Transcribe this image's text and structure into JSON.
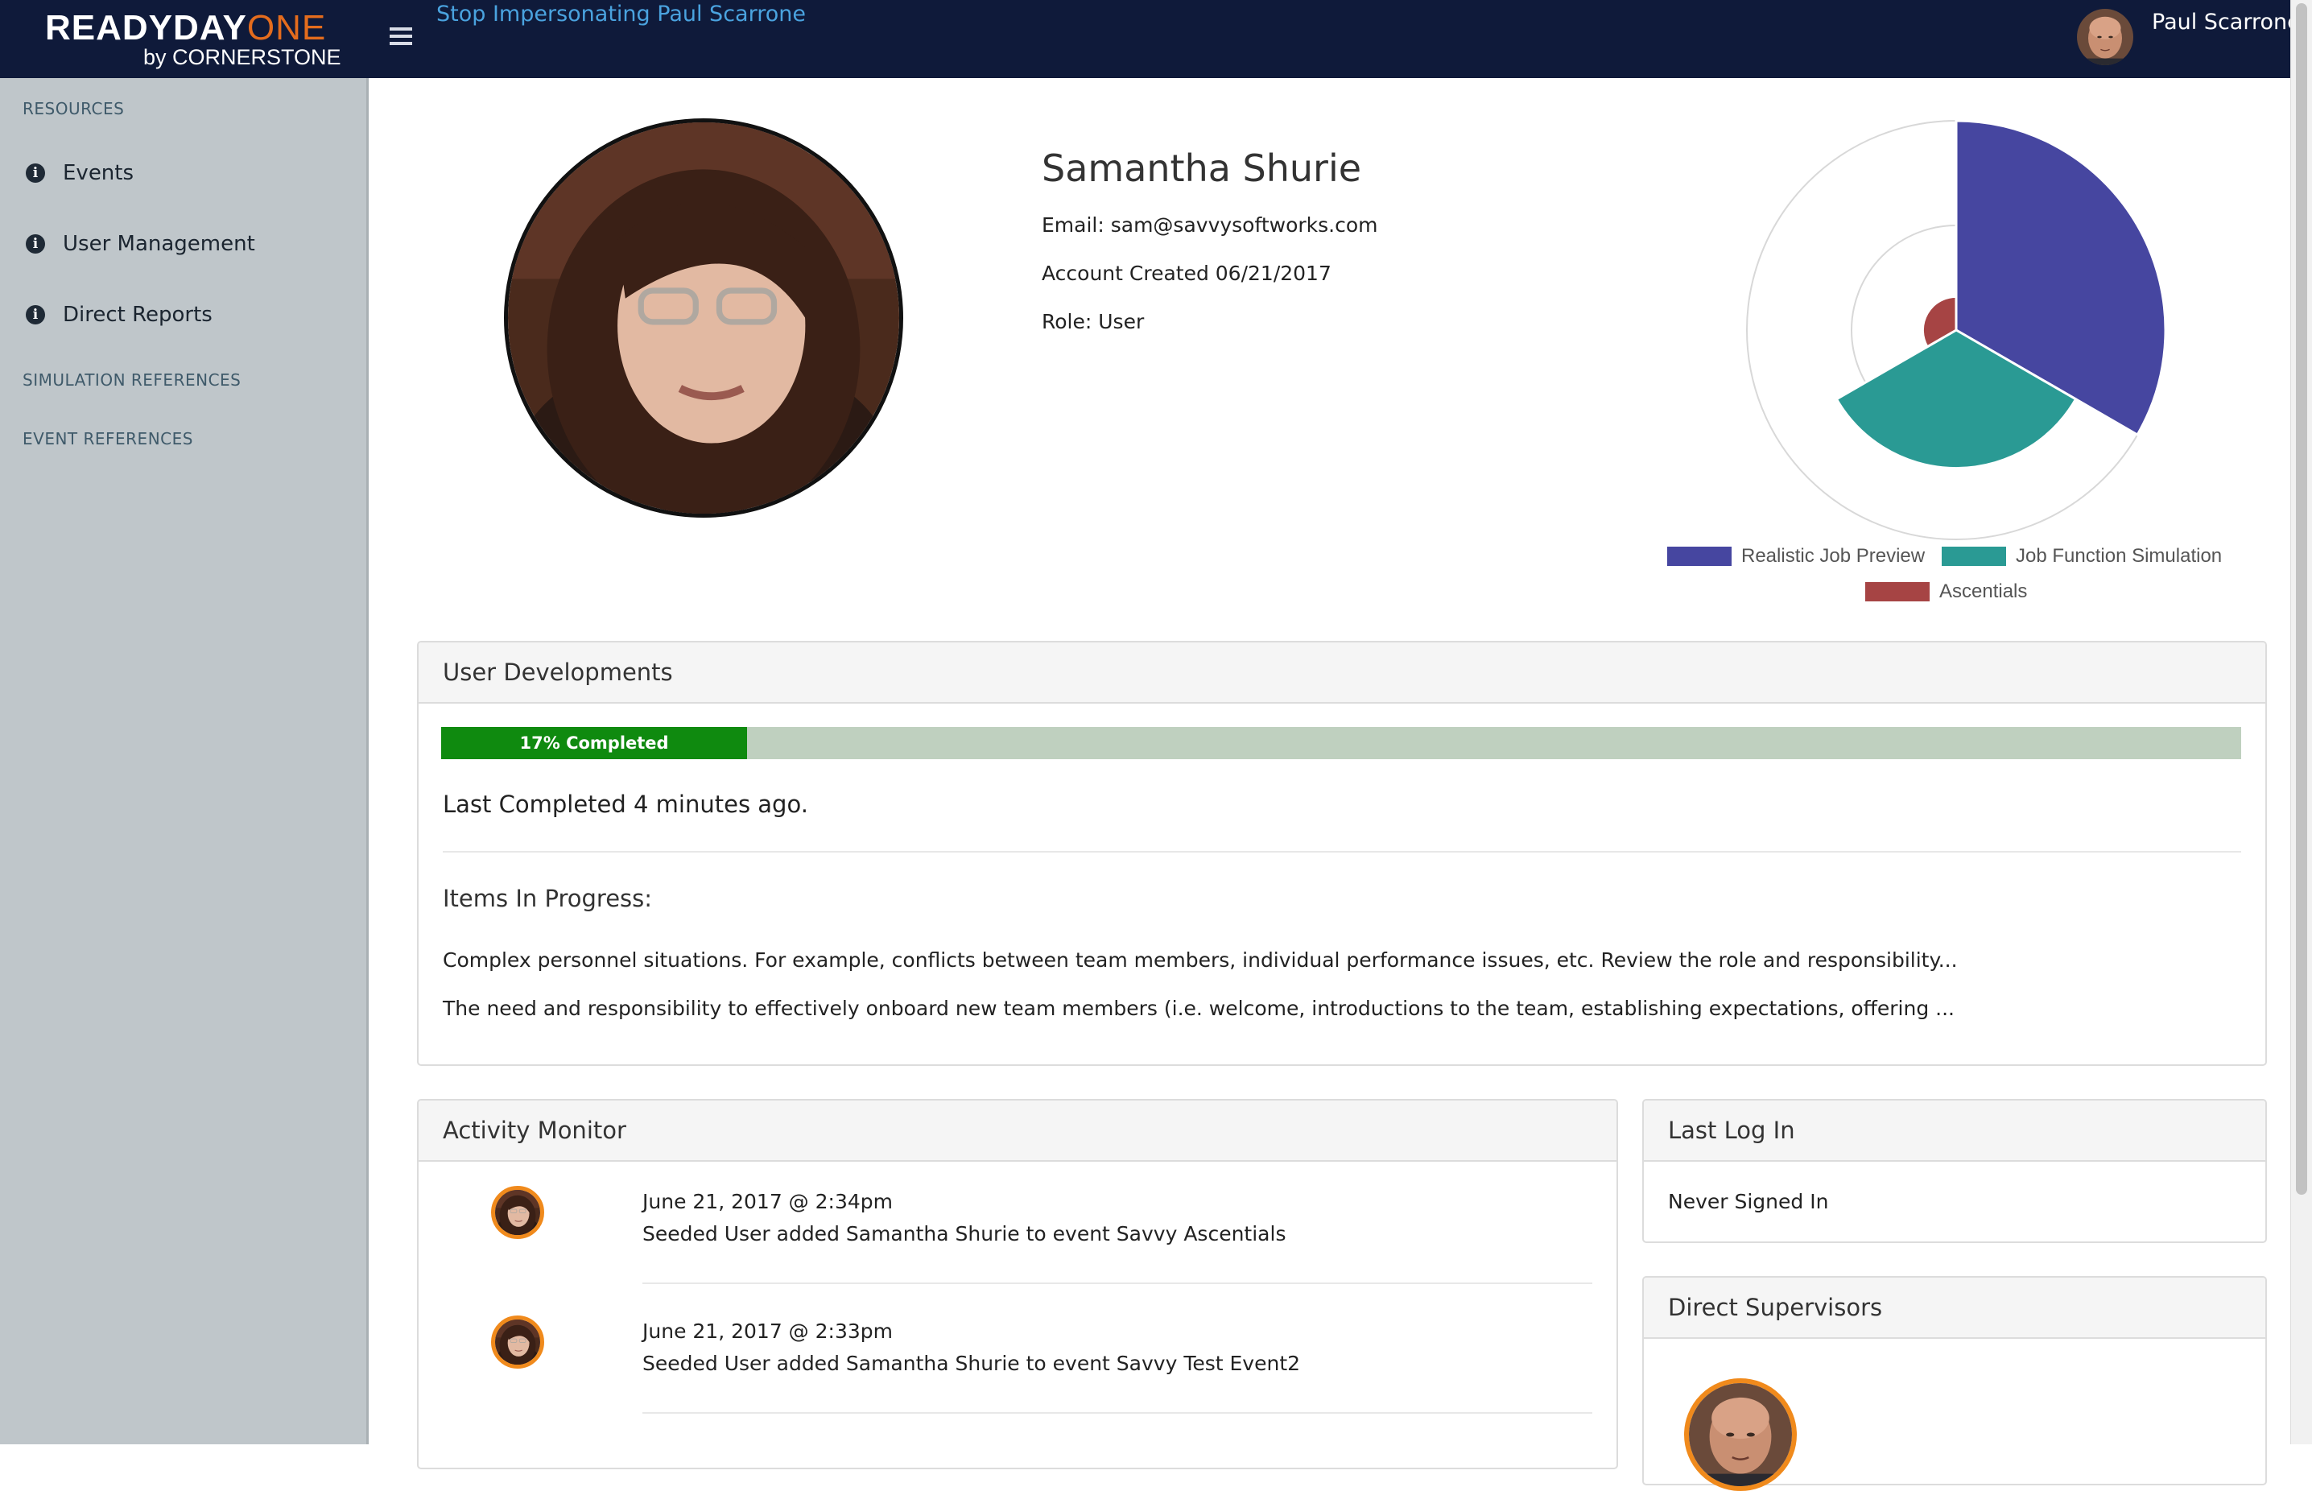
{
  "topbar": {
    "logo_main": "READYDAY",
    "logo_accent": "ONE",
    "logo_sub": "by CORNERSTONE",
    "stop_impersonating": "Stop Impersonating Paul Scarrone",
    "user_name": "Paul Scarrone"
  },
  "sidebar": {
    "sections": {
      "resources": "RESOURCES",
      "simulation_references": "SIMULATION REFERENCES",
      "event_references": "EVENT REFERENCES"
    },
    "items": [
      {
        "label": "Events",
        "icon": "info-icon"
      },
      {
        "label": "User Management",
        "icon": "info-icon"
      },
      {
        "label": "Direct Reports",
        "icon": "info-icon"
      }
    ]
  },
  "profile": {
    "name": "Samantha Shurie",
    "email": "Email: sam@savvysoftworks.com",
    "created": "Account Created 06/21/2017",
    "role": "Role: User"
  },
  "chart_data": {
    "type": "polarArea",
    "series": [
      {
        "name": "Realistic Job Preview",
        "value": 1.0,
        "color": "#4646a0"
      },
      {
        "name": "Job Function Simulation",
        "value": 0.66,
        "color": "#2a9a94"
      },
      {
        "name": "Ascentials",
        "value": 0.16,
        "color": "#a64444"
      }
    ],
    "grid_rings": 2,
    "legend_position": "bottom"
  },
  "developments": {
    "title": "User Developments",
    "progress_fraction": 0.17,
    "progress_label": "17% Completed",
    "last_completed": "Last Completed 4 minutes ago.",
    "items_heading": "Items In Progress:",
    "items": [
      "Complex personnel situations. For example, conflicts between team members, individual performance issues, etc. Review the role and responsibility...",
      "The need and responsibility to effectively onboard new team members (i.e. welcome, introductions to the team, establishing expectations, offering ..."
    ]
  },
  "activity": {
    "title": "Activity Monitor",
    "entries": [
      {
        "time": "June 21, 2017 @ 2:34pm",
        "text": "Seeded User added Samantha Shurie to event Savvy Ascentials"
      },
      {
        "time": "June 21, 2017 @ 2:33pm",
        "text": "Seeded User added Samantha Shurie to event Savvy Test Event2"
      }
    ]
  },
  "last_login": {
    "title": "Last Log In",
    "value": "Never Signed In"
  },
  "supervisors": {
    "title": "Direct Supervisors"
  },
  "colors": {
    "topbar": "#0f1a3a",
    "sidebar": "#bfc6ca",
    "link": "#4aa3df",
    "progress_fill": "#0f8a0f",
    "progress_track": "#bfd0bf",
    "avatar_ring": "#f08a1c"
  }
}
